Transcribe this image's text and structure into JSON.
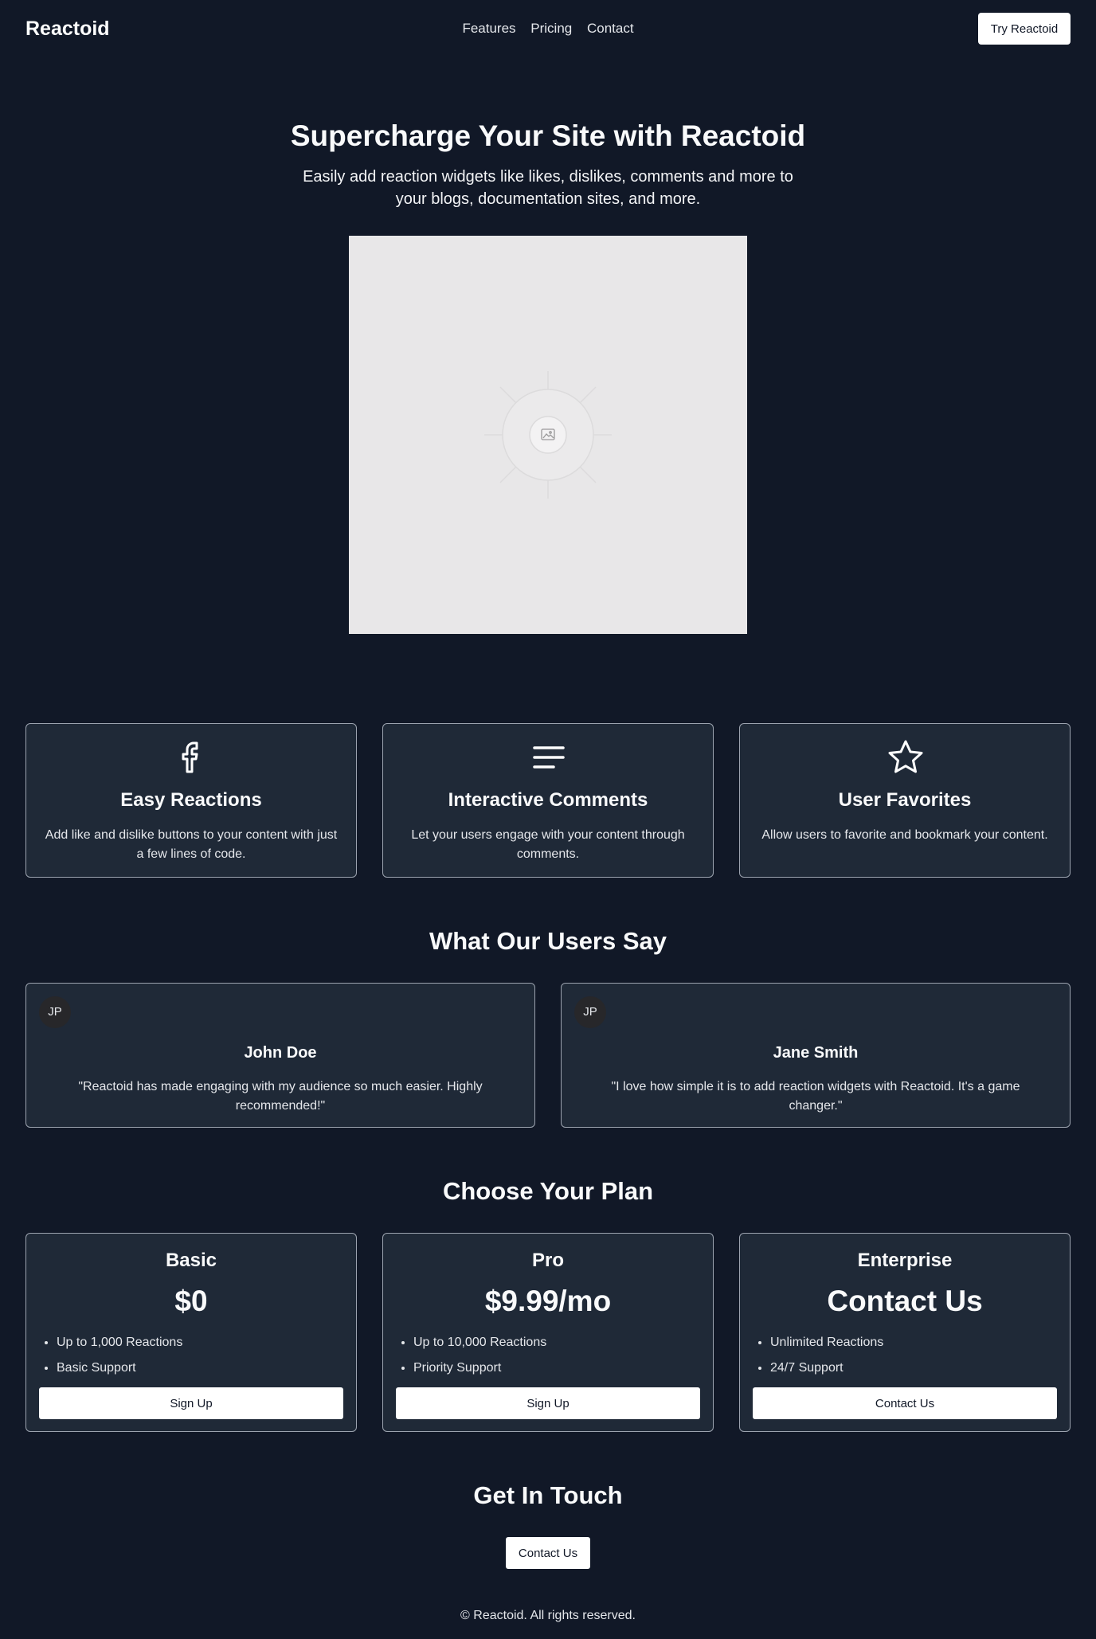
{
  "header": {
    "brand": "Reactoid",
    "nav": [
      "Features",
      "Pricing",
      "Contact"
    ],
    "cta": "Try Reactoid"
  },
  "hero": {
    "title": "Supercharge Your Site with Reactoid",
    "subtitle": "Easily add reaction widgets like likes, dislikes, comments and more to your blogs, documentation sites, and more.",
    "image_icon": "image-placeholder-icon"
  },
  "features": [
    {
      "icon": "facebook-icon",
      "title": "Easy Reactions",
      "text": "Add like and dislike buttons to your content with just a few lines of code."
    },
    {
      "icon": "text-lines-icon",
      "title": "Interactive Comments",
      "text": "Let your users engage with your content through comments."
    },
    {
      "icon": "star-icon",
      "title": "User Favorites",
      "text": "Allow users to favorite and bookmark your content."
    }
  ],
  "testimonials": {
    "title": "What Our Users Say",
    "items": [
      {
        "initials": "JP",
        "name": "John Doe",
        "quote": "\"Reactoid has made engaging with my audience so much easier. Highly recommended!\""
      },
      {
        "initials": "JP",
        "name": "Jane Smith",
        "quote": "\"I love how simple it is to add reaction widgets with Reactoid. It's a game changer.\""
      }
    ]
  },
  "pricing": {
    "title": "Choose Your Plan",
    "plans": [
      {
        "name": "Basic",
        "price": "$0",
        "features": [
          "Up to 1,000 Reactions",
          "Basic Support"
        ],
        "button": "Sign Up"
      },
      {
        "name": "Pro",
        "price": "$9.99/mo",
        "features": [
          "Up to 10,000 Reactions",
          "Priority Support"
        ],
        "button": "Sign Up"
      },
      {
        "name": "Enterprise",
        "price": "Contact Us",
        "features": [
          "Unlimited Reactions",
          "24/7 Support"
        ],
        "button": "Contact Us"
      }
    ]
  },
  "contact": {
    "title": "Get In Touch",
    "button": "Contact Us"
  },
  "footer": {
    "text": "© Reactoid. All rights reserved."
  },
  "colors": {
    "background": "#111827",
    "card": "#1f2937",
    "card_border": "#9ca3af",
    "button_bg": "#ffffff"
  }
}
